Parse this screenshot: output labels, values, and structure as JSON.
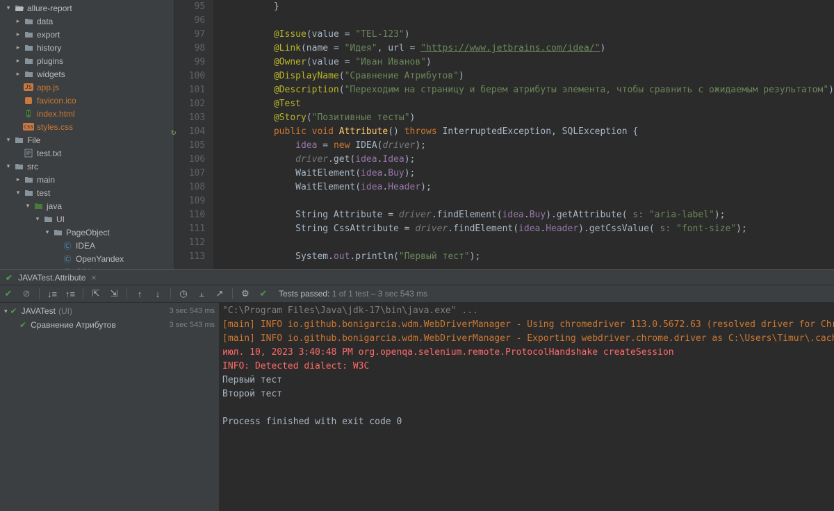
{
  "project_tree": [
    {
      "depth": 0,
      "chev": "v",
      "icon": "folder-open",
      "label": "allure-report",
      "cls": ""
    },
    {
      "depth": 1,
      "chev": ">",
      "icon": "folder-closed",
      "label": "data",
      "cls": ""
    },
    {
      "depth": 1,
      "chev": ">",
      "icon": "folder-closed",
      "label": "export",
      "cls": ""
    },
    {
      "depth": 1,
      "chev": ">",
      "icon": "folder-closed",
      "label": "history",
      "cls": ""
    },
    {
      "depth": 1,
      "chev": ">",
      "icon": "folder-closed",
      "label": "plugins",
      "cls": ""
    },
    {
      "depth": 1,
      "chev": ">",
      "icon": "folder-closed",
      "label": "widgets",
      "cls": ""
    },
    {
      "depth": 1,
      "chev": "",
      "icon": "file-js",
      "label": "app.js",
      "cls": "orange"
    },
    {
      "depth": 1,
      "chev": "",
      "icon": "file-ico",
      "label": "favicon.ico",
      "cls": "orange"
    },
    {
      "depth": 1,
      "chev": "",
      "icon": "file-html",
      "label": "index.html",
      "cls": "orange"
    },
    {
      "depth": 1,
      "chev": "",
      "icon": "file-css",
      "label": "styles.css",
      "cls": "orange"
    },
    {
      "depth": 0,
      "chev": "v",
      "icon": "folder-closed",
      "label": "File",
      "cls": ""
    },
    {
      "depth": 1,
      "chev": "",
      "icon": "file-txt",
      "label": "test.txt",
      "cls": ""
    },
    {
      "depth": 0,
      "chev": "v",
      "icon": "folder-closed",
      "label": "src",
      "cls": ""
    },
    {
      "depth": 1,
      "chev": ">",
      "icon": "folder-closed",
      "label": "main",
      "cls": ""
    },
    {
      "depth": 1,
      "chev": "v",
      "icon": "folder-closed",
      "label": "test",
      "cls": ""
    },
    {
      "depth": 2,
      "chev": "v",
      "icon": "folder-test",
      "label": "java",
      "cls": ""
    },
    {
      "depth": 3,
      "chev": "v",
      "icon": "folder-closed",
      "label": "UI",
      "cls": ""
    },
    {
      "depth": 4,
      "chev": "v",
      "icon": "folder-closed",
      "label": "PageObject",
      "cls": ""
    },
    {
      "depth": 5,
      "chev": "",
      "icon": "file-java",
      "label": "IDEA",
      "cls": ""
    },
    {
      "depth": 5,
      "chev": "",
      "icon": "file-java",
      "label": "OpenYandex",
      "cls": ""
    },
    {
      "depth": 5,
      "chev": "",
      "icon": "file-java",
      "label": "SQL",
      "cls": ""
    }
  ],
  "editor": {
    "first_line_no": 95,
    "gutter_mark_line": 104,
    "lines": [
      {
        "n": 95,
        "html": "        }"
      },
      {
        "n": 96,
        "html": ""
      },
      {
        "n": 97,
        "html": "        <span class='c-ann'>@Issue</span>(value = <span class='c-str'>\"TEL-123\"</span>)"
      },
      {
        "n": 98,
        "html": "        <span class='c-ann'>@Link</span>(name = <span class='c-str'>\"Идея\"</span>, url = <span class='c-url'>\"https://www.jetbrains.com/idea/\"</span>)"
      },
      {
        "n": 99,
        "html": "        <span class='c-ann'>@Owner</span>(value = <span class='c-str'>\"Иван Иванов\"</span>)"
      },
      {
        "n": 100,
        "html": "        <span class='c-ann'>@DisplayName</span>(<span class='c-str'>\"Сравнение Атрибутов\"</span>)"
      },
      {
        "n": 101,
        "html": "        <span class='c-ann'>@Description</span>(<span class='c-str'>\"Переходим на страницу и берем атрибуты элемента, чтобы сравнить с ожидаемым результатом\"</span>)"
      },
      {
        "n": 102,
        "html": "        <span class='c-ann'>@Test</span>"
      },
      {
        "n": 103,
        "html": "        <span class='c-ann'>@Story</span>(<span class='c-str'>\"Позитивные тесты\"</span>)"
      },
      {
        "n": 104,
        "html": "        <span class='c-kw'>public void</span> <span class='c-fn'>Attribute</span>() <span class='c-kw'>throws</span> InterruptedException, SQLException {"
      },
      {
        "n": 105,
        "html": "            <span class='c-id'>idea</span> = <span class='c-kw'>new</span> IDEA(<span class='c-id c-gut'>driver</span>);"
      },
      {
        "n": 106,
        "html": "            <span class='c-id c-gut'>driver</span>.get(<span class='c-id'>idea</span>.<span class='c-id'>Idea</span>);"
      },
      {
        "n": 107,
        "html": "            WaitElement(<span class='c-id'>idea</span>.<span class='c-id'>Buy</span>);"
      },
      {
        "n": 108,
        "html": "            WaitElement(<span class='c-id'>idea</span>.<span class='c-id'>Header</span>);"
      },
      {
        "n": 109,
        "html": ""
      },
      {
        "n": 110,
        "html": "            String Attribute = <span class='c-id c-gut'>driver</span>.findElement(<span class='c-id'>idea</span>.<span class='c-id'>Buy</span>).getAttribute(<span class='c-comment'> s: </span><span class='c-str'>\"aria-label\"</span>);"
      },
      {
        "n": 111,
        "html": "            String CssAttribute = <span class='c-id c-gut'>driver</span>.findElement(<span class='c-id'>idea</span>.<span class='c-id'>Header</span>).getCssValue(<span class='c-comment'> s: </span><span class='c-str'>\"font-size\"</span>);"
      },
      {
        "n": 112,
        "html": ""
      },
      {
        "n": 113,
        "html": "            System.<span class='c-id'>out</span>.println(<span class='c-str'>\"Первый тест\"</span>);"
      }
    ]
  },
  "run_tab": {
    "label": "JAVATest.Attribute"
  },
  "toolbar_status": {
    "prefix": "Tests passed:",
    "count": "1",
    "suffix": "of 1 test – 3 sec 543 ms"
  },
  "test_tree": [
    {
      "depth": 0,
      "chev": "v",
      "name": "JAVATest",
      "suffix": "(UI)",
      "time": "3 sec 543 ms"
    },
    {
      "depth": 1,
      "chev": "",
      "name": "Сравнение Атрибутов",
      "suffix": "",
      "time": "3 sec 543 ms"
    }
  ],
  "console_lines": [
    {
      "cls": "dim",
      "text": "\"C:\\Program Files\\Java\\jdk-17\\bin\\java.exe\" ..."
    },
    {
      "cls": "warn",
      "text": "[main] INFO io.github.bonigarcia.wdm.WebDriverManager - Using chromedriver 113.0.5672.63 (resolved driver for Chrome "
    },
    {
      "cls": "warn",
      "text": "[main] INFO io.github.bonigarcia.wdm.WebDriverManager - Exporting webdriver.chrome.driver as C:\\Users\\Timur\\.cache\\se"
    },
    {
      "cls": "red",
      "text": "июл. 10, 2023 3:40:48 PM org.openqa.selenium.remote.ProtocolHandshake createSession"
    },
    {
      "cls": "red",
      "text": "INFO: Detected dialect: W3C"
    },
    {
      "cls": "info",
      "text": "Первый тест"
    },
    {
      "cls": "info",
      "text": "Второй тест"
    },
    {
      "cls": "info",
      "text": ""
    },
    {
      "cls": "info",
      "text": "Process finished with exit code 0"
    }
  ]
}
